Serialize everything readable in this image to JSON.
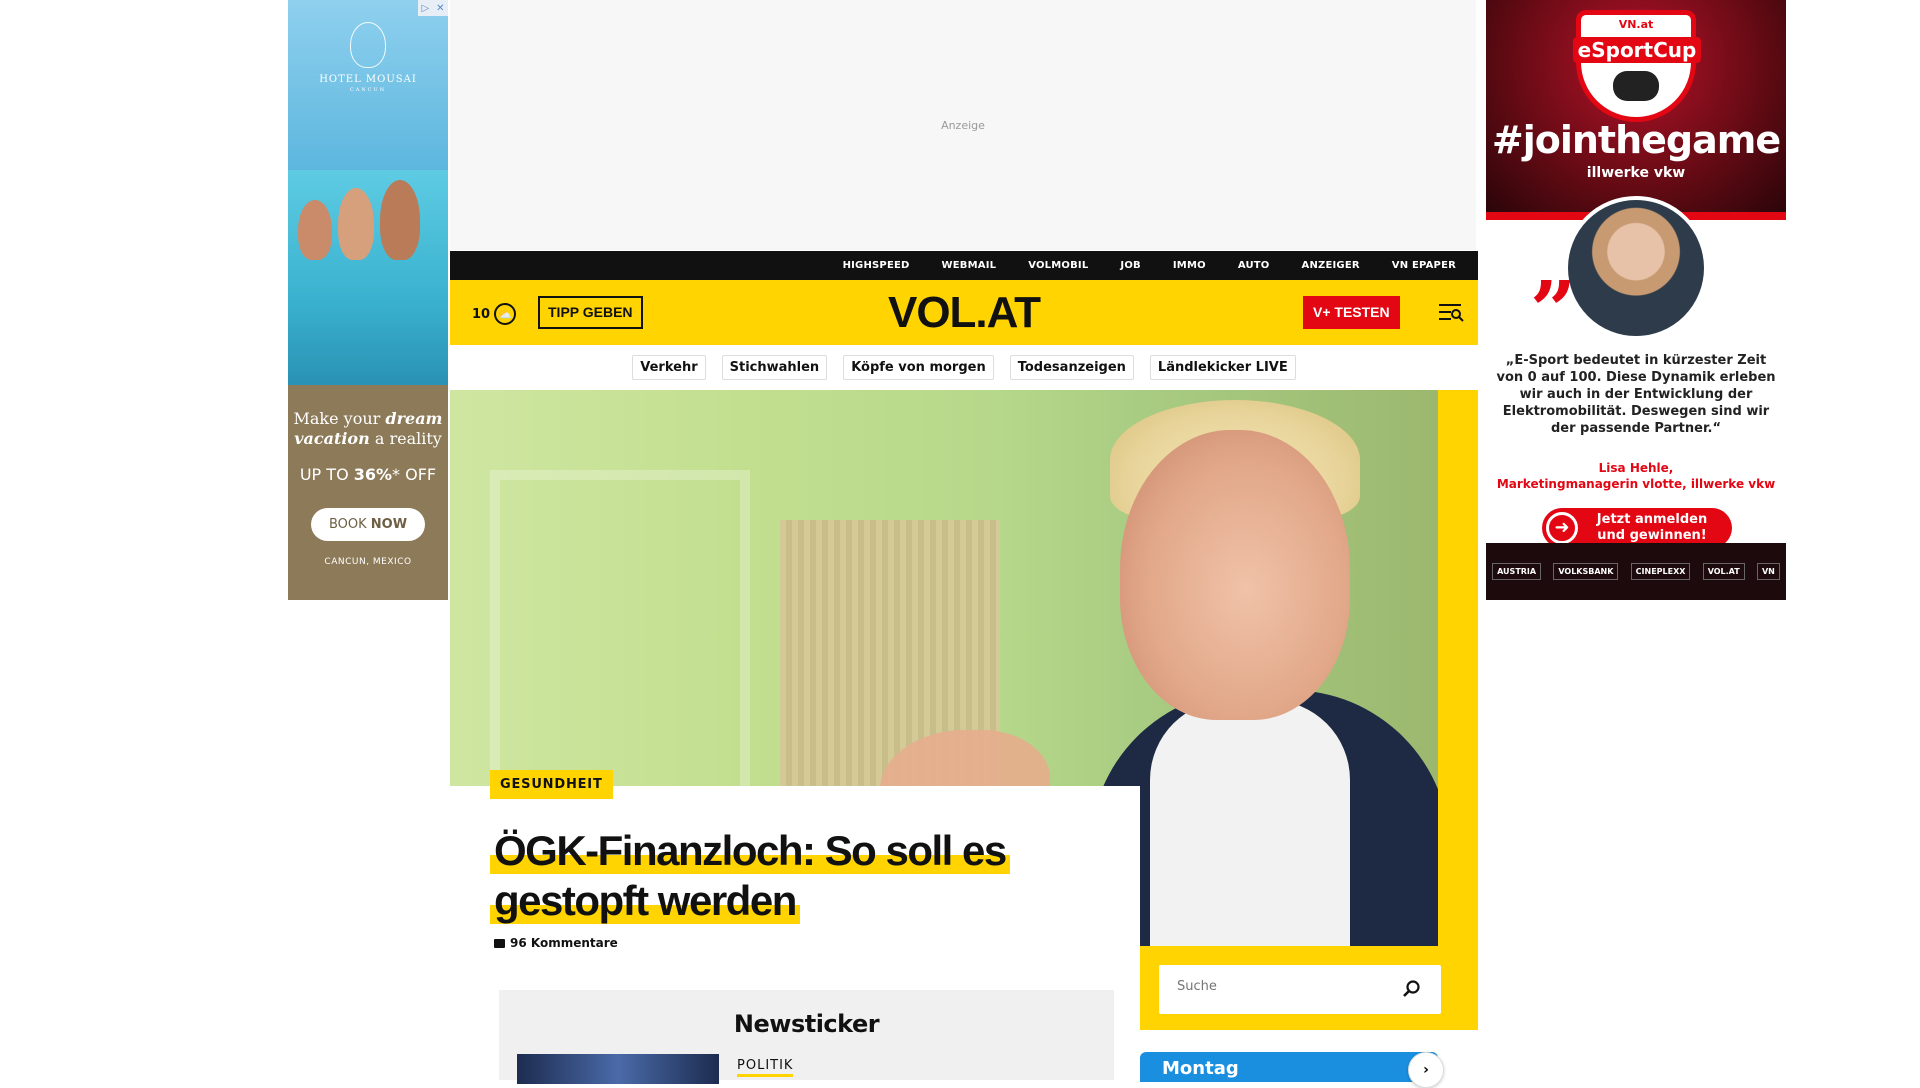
{
  "ads": {
    "left": {
      "brand": "HOTEL MOUSAI",
      "brand_sub": "CANCUN",
      "tagline_pre": "Make your ",
      "tagline_em1": "dream",
      "tagline_em2": "vacation",
      "tagline_post": " a reality",
      "offer_pre": "UP TO ",
      "offer_value": "36%",
      "offer_post": "* OFF",
      "button_pre": "BOOK ",
      "button_bold": "NOW",
      "location": "CANCUN, MEXICO",
      "adchoice_left": "▷",
      "adchoice_right": "✕"
    },
    "top": {
      "label": "Anzeige"
    },
    "right": {
      "top_label": "VN.at",
      "banner": "eSportCup",
      "hashtag": "#jointhegame",
      "powered_by": "illwerke vkw",
      "quote": "„E-Sport bedeutet in kürzester Zeit von 0 auf 100. Diese Dynamik erleben wir auch in der Entwicklung der Elektromobilität. Deswegen sind wir der passende Partner.“",
      "author_name": "Lisa Hehle,",
      "author_role": "Marketingmanagerin vlotte, illwerke vkw",
      "cta_line1": "Jetzt anmelden",
      "cta_line2": "und gewinnen!",
      "sponsors": [
        "AUSTRIA",
        "VOLKSBANK",
        "CINEPLEXX",
        "VOL.AT",
        "VN"
      ]
    }
  },
  "topnav": [
    "HIGHSPEED",
    "WEBMAIL",
    "VOLMOBIL",
    "JOB",
    "IMMO",
    "AUTO",
    "ANZEIGER",
    "VN EPAPER"
  ],
  "header": {
    "temperature": "10",
    "tipp_label": "TIPP GEBEN",
    "logo": "VOL.AT",
    "subscribe_label": "V+ TESTEN"
  },
  "pills": [
    "Verkehr",
    "Stichwahlen",
    "Köpfe von morgen",
    "Todesanzeigen",
    "Ländlekicker LIVE"
  ],
  "article": {
    "category": "GESUNDHEIT",
    "headline": "ÖGK-Finanzloch: So soll es gestopft werden",
    "comments": "96 Kommentare"
  },
  "newsticker": {
    "title": "Newsticker",
    "first_category": "POLITIK"
  },
  "search": {
    "placeholder": "Suche"
  },
  "weather_widget": {
    "day": "Montag",
    "next": "›"
  },
  "colors": {
    "brand_yellow": "#ffd400",
    "accent_red": "#e30613",
    "nav_black": "#111111"
  }
}
